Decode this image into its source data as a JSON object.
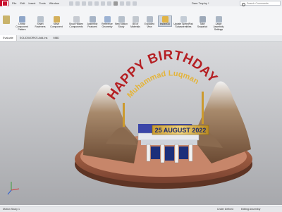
{
  "menubar": {
    "items": [
      "File",
      "Edit",
      "Insert",
      "Tools",
      "Window"
    ],
    "document_title": "Dam Trophy *",
    "search_placeholder": "Search Commands"
  },
  "ribbon": {
    "tools": [
      {
        "label": "Linear Component Pattern",
        "icon": "pattern-icon"
      },
      {
        "label": "Smart Fasteners",
        "icon": "fastener-icon"
      },
      {
        "label": "Move Component",
        "icon": "move-icon"
      },
      {
        "label": "Show Hidden Components",
        "icon": "show-hidden-icon"
      },
      {
        "label": "Assembly Features",
        "icon": "assembly-features-icon"
      },
      {
        "label": "Reference Geometry",
        "icon": "reference-geometry-icon"
      },
      {
        "label": "New Motion Study",
        "icon": "motion-study-icon"
      },
      {
        "label": "Bill of Materials",
        "icon": "bom-icon"
      },
      {
        "label": "Exploded View",
        "icon": "exploded-view-icon"
      },
      {
        "label": "Instant3D",
        "icon": "instant3d-icon"
      },
      {
        "label": "Update SpeedPak Subassemblies",
        "icon": "speedpak-icon"
      },
      {
        "label": "Take Snapshot",
        "icon": "snapshot-icon"
      },
      {
        "label": "Large Assembly Settings",
        "icon": "large-assembly-icon"
      }
    ]
  },
  "tabs": [
    "Evaluate",
    "SOLIDWORKS Add-Ins",
    "MBD"
  ],
  "model": {
    "title": "HAPPY BIRTHDAY",
    "name": "Muhammad Luqman",
    "date": "25 AUGUST 2022"
  },
  "status": {
    "left": "Motion Study 1",
    "mid": "Under Defined",
    "right": "Editing Assembly"
  }
}
